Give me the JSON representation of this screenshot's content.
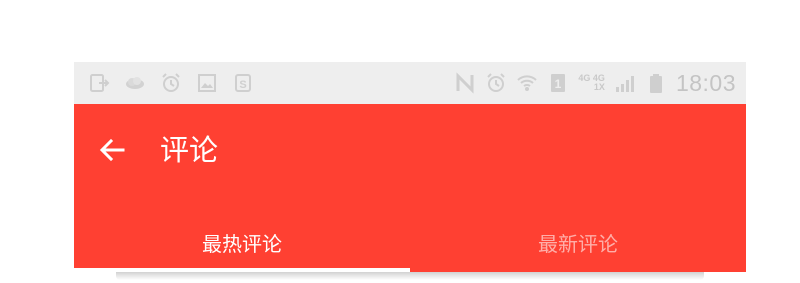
{
  "status_bar": {
    "left_icons": [
      "notification-exit-icon",
      "cloud-icon",
      "alarm-icon",
      "image-icon",
      "app-s-icon"
    ],
    "right_icons": [
      "nfc-icon",
      "alarm-icon",
      "wifi-icon",
      "sim-1-icon",
      "signal-icon",
      "battery-icon"
    ],
    "net_top": "4G 4G",
    "net_bottom": "1X",
    "time": "18:03"
  },
  "app_bar": {
    "title": "评论",
    "accent_color": "#ff4032"
  },
  "tabs": [
    {
      "label": "最热评论",
      "selected": true
    },
    {
      "label": "最新评论",
      "selected": false
    }
  ]
}
